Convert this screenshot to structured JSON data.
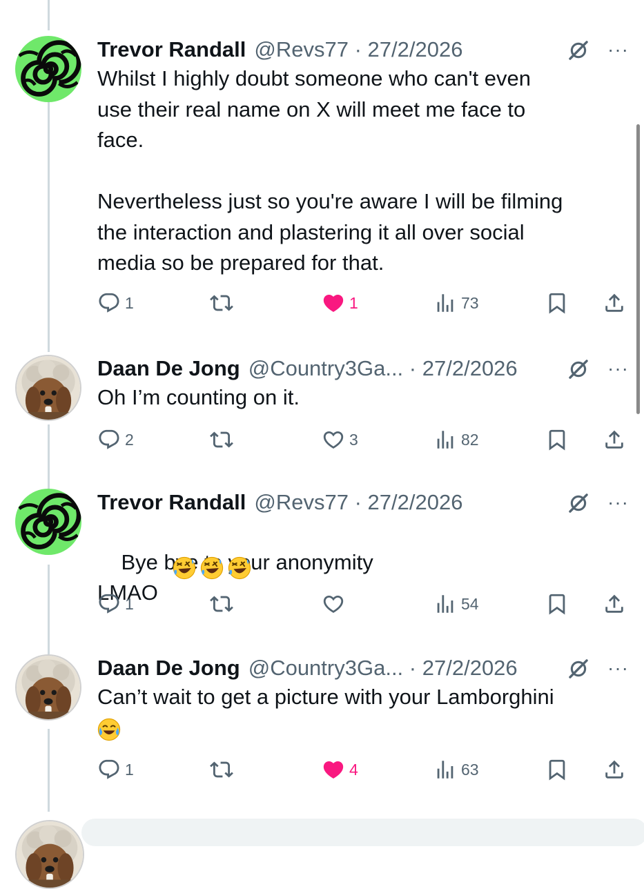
{
  "tweets": [
    {
      "name": "Trevor Randall",
      "handle": "@Revs77",
      "date": "27/2/2026",
      "text": "Whilst I highly doubt someone who can't even\nuse their real name on X will meet me face to\nface.\n\nNevertheless just so you're aware I will be filming\nthe interaction and plastering it all over social\nmedia so be prepared for that.",
      "replies": "1",
      "reposts": "",
      "likes": "1",
      "liked": true,
      "views": "73",
      "avatar": "green-spiral"
    },
    {
      "name": "Daan De Jong",
      "handle": "@Country3Ga...",
      "date": "27/2/2026",
      "text": "Oh I’m counting on it.",
      "replies": "2",
      "reposts": "",
      "likes": "3",
      "liked": false,
      "views": "82",
      "avatar": "dog-with-wig"
    },
    {
      "name": "Trevor Randall",
      "handle": "@Revs77",
      "date": "27/2/2026",
      "text": "Bye bye to your anonymity\nLMAO",
      "emoji_after": [
        "rofl-emoji",
        "rofl-emoji",
        "rofl-emoji"
      ],
      "replies": "1",
      "reposts": "",
      "likes": "",
      "liked": false,
      "views": "54",
      "avatar": "green-spiral"
    },
    {
      "name": "Daan De Jong",
      "handle": "@Country3Ga...",
      "date": "27/2/2026",
      "text": "Can’t wait to get a picture with your Lamborghini",
      "emoji_line": [
        "joy-emoji"
      ],
      "replies": "1",
      "reposts": "",
      "likes": "4",
      "liked": true,
      "views": "63",
      "avatar": "dog-with-wig"
    }
  ],
  "separator": "·",
  "more_glyph": "···",
  "icons": {
    "reply": "reply-icon",
    "repost": "repost-icon",
    "like": "heart-icon",
    "views": "views-icon",
    "bookmark": "bookmark-icon",
    "share": "share-icon",
    "grok": "grok-icon"
  },
  "colors": {
    "text": "#0f1419",
    "secondary": "#536471",
    "like": "#f91880",
    "thread_line": "#cfd9de",
    "spiral_green": "#6fe86a"
  }
}
